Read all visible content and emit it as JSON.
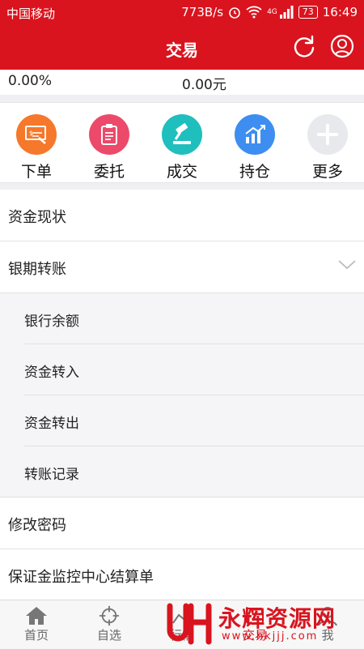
{
  "statusbar": {
    "carrier": "中国移动",
    "speed": "773B/s",
    "network": "4G",
    "battery": "73",
    "time": "16:49"
  },
  "header": {
    "title": "交易"
  },
  "summary": {
    "left_value": "0.00%",
    "right_value": "0.00元"
  },
  "quick_actions": [
    {
      "label": "下单",
      "color": "#f5782b",
      "icon": "order-icon"
    },
    {
      "label": "委托",
      "color": "#ec4a6a",
      "icon": "clipboard-icon"
    },
    {
      "label": "成交",
      "color": "#1fbfbd",
      "icon": "gavel-icon"
    },
    {
      "label": "持仓",
      "color": "#3d8ef0",
      "icon": "chart-icon"
    },
    {
      "label": "更多",
      "color": "#e8e9ec",
      "icon": "plus-icon"
    }
  ],
  "menu": {
    "fund_status": "资金现状",
    "bank_transfer": "银期转账",
    "sub_items": [
      "银行余额",
      "资金转入",
      "资金转出",
      "转账记录"
    ],
    "change_password": "修改密码",
    "margin_statement": "保证金监控中心结算单"
  },
  "tabs": [
    "首页",
    "自选",
    "行情",
    "交易",
    "我"
  ],
  "watermark": {
    "name": "永辉资源网",
    "url": "www.hkjjj.com"
  },
  "colors": {
    "brand": "#d9141e"
  }
}
